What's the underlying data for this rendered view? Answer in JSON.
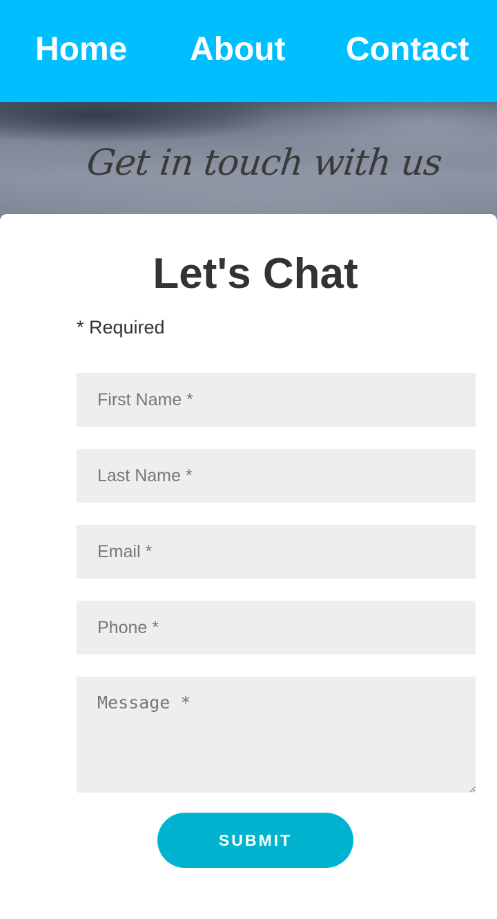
{
  "nav": {
    "items": [
      {
        "label": "Home"
      },
      {
        "label": "About"
      },
      {
        "label": "Contact"
      }
    ],
    "background_color": "#00bfff"
  },
  "hero": {
    "title": "Get in touch with us"
  },
  "form": {
    "heading": "Let's Chat",
    "required_note": "* Required",
    "fields": {
      "first_name": {
        "placeholder": "First Name *",
        "value": ""
      },
      "last_name": {
        "placeholder": "Last Name *",
        "value": ""
      },
      "email": {
        "placeholder": "Email *",
        "value": ""
      },
      "phone": {
        "placeholder": "Phone *",
        "value": ""
      },
      "message": {
        "placeholder": "Message *",
        "value": ""
      }
    },
    "submit_label": "SUBMIT",
    "field_background": "#eeeeee",
    "submit_color": "#00b4d0"
  }
}
